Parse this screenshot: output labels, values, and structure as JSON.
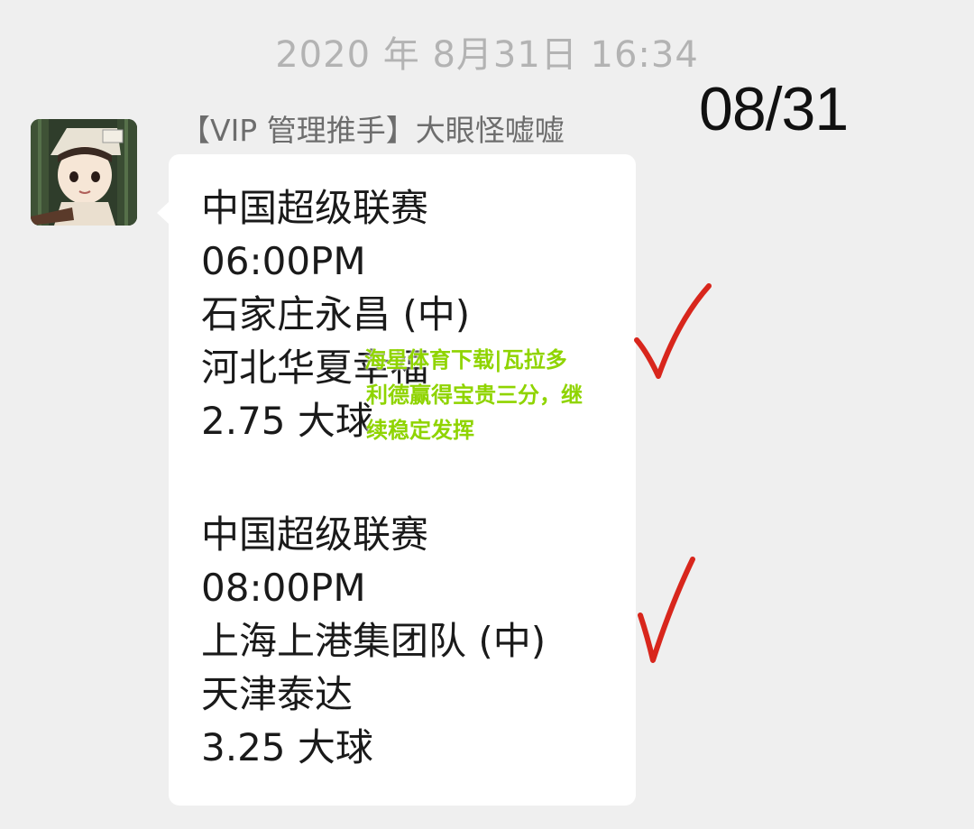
{
  "timestamp": "2020 年 8月31日 16:34",
  "date_annotation": "08/31",
  "sender": "【VIP 管理推手】大眼怪嘘嘘",
  "avatar_icon": "cartoon-avatar-icon",
  "messages": [
    {
      "league": "中国超级联赛",
      "time": "06:00PM",
      "home": "石家庄永昌 (中)",
      "away": "河北华夏幸福",
      "pick": "2.75 大球",
      "checked": true
    },
    {
      "league": "中国超级联赛",
      "time": "08:00PM",
      "home": "上海上港集团队 (中)",
      "away": "天津泰达",
      "pick": "3.25 大球",
      "checked": true
    }
  ],
  "watermark": {
    "line1": "海星体育下载|瓦拉多",
    "line2": "利德赢得宝贵三分，继",
    "line3": "续稳定发挥",
    "color": "#8fd400"
  },
  "colors": {
    "background": "#efefef",
    "bubble": "#ffffff",
    "checkmark": "#d8261c",
    "timestamp": "#b3b3b3"
  }
}
